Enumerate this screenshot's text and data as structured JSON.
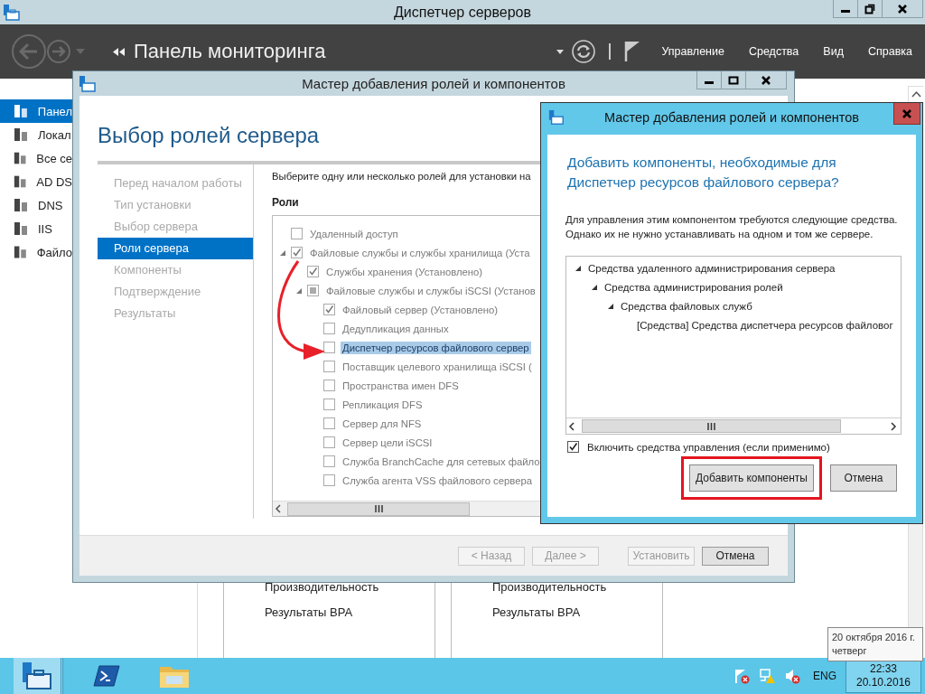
{
  "window": {
    "title": "Диспетчер серверов"
  },
  "header": {
    "breadcrumb": "Панель мониторинга",
    "menu": [
      "Управление",
      "Средства",
      "Вид",
      "Справка"
    ]
  },
  "sidebar": {
    "items": [
      {
        "label": "Панел",
        "selected": true
      },
      {
        "label": "Локал",
        "selected": false
      },
      {
        "label": "Все се",
        "selected": false
      },
      {
        "label": "AD DS",
        "selected": false
      },
      {
        "label": "DNS",
        "selected": false
      },
      {
        "label": "IIS",
        "selected": false
      },
      {
        "label": "Файло",
        "selected": false
      }
    ]
  },
  "tiles": [
    {
      "lines": [
        "Производительность",
        "Результаты BPA"
      ]
    },
    {
      "lines": [
        "Производительность",
        "Результаты BPA"
      ]
    }
  ],
  "wizard": {
    "title": "Мастер добавления ролей и компонентов",
    "heading": "Выбор ролей сервера",
    "steps": [
      {
        "label": "Перед началом работы",
        "selected": false
      },
      {
        "label": "Тип установки",
        "selected": false
      },
      {
        "label": "Выбор сервера",
        "selected": false
      },
      {
        "label": "Роли сервера",
        "selected": true
      },
      {
        "label": "Компоненты",
        "selected": false
      },
      {
        "label": "Подтверждение",
        "selected": false
      },
      {
        "label": "Результаты",
        "selected": false
      }
    ],
    "instruction": "Выберите одну или несколько ролей для установки на",
    "roles_label": "Роли",
    "roles": [
      {
        "label": "Удаленный доступ",
        "checked": false,
        "indeterminate": false,
        "selected": false
      },
      {
        "label": "Файловые службы и службы хранилища (Уста",
        "checked": true,
        "indeterminate": false,
        "selected": false,
        "expanded": true,
        "children": [
          {
            "label": "Службы хранения (Установлено)",
            "checked": true,
            "indeterminate": false,
            "selected": false
          },
          {
            "label": "Файловые службы и службы iSCSI (Установ",
            "checked": true,
            "indeterminate": true,
            "selected": false,
            "expanded": true,
            "children": [
              {
                "label": "Файловый сервер (Установлено)",
                "checked": true,
                "indeterminate": false,
                "selected": false
              },
              {
                "label": "Дедупликация данных",
                "checked": false,
                "indeterminate": false,
                "selected": false
              },
              {
                "label": "Диспетчер ресурсов файлового сервер",
                "checked": false,
                "indeterminate": false,
                "selected": true
              },
              {
                "label": "Поставщик целевого хранилища iSCSI (",
                "checked": false,
                "indeterminate": false,
                "selected": false
              },
              {
                "label": "Пространства имен DFS",
                "checked": false,
                "indeterminate": false,
                "selected": false
              },
              {
                "label": "Репликация DFS",
                "checked": false,
                "indeterminate": false,
                "selected": false
              },
              {
                "label": "Сервер для NFS",
                "checked": false,
                "indeterminate": false,
                "selected": false
              },
              {
                "label": "Сервер цели iSCSI",
                "checked": false,
                "indeterminate": false,
                "selected": false
              },
              {
                "label": "Служба BranchCache для сетевых файло",
                "checked": false,
                "indeterminate": false,
                "selected": false
              },
              {
                "label": "Служба агента VSS файлового сервера",
                "checked": false,
                "indeterminate": false,
                "selected": false
              }
            ]
          }
        ]
      }
    ],
    "buttons": [
      {
        "label": "< Назад",
        "disabled": true
      },
      {
        "label": "Далее >",
        "disabled": true
      },
      {
        "label": "Установить",
        "disabled": true
      },
      {
        "label": "Отмена",
        "disabled": false
      }
    ]
  },
  "dialog": {
    "title": "Мастер добавления ролей и компонентов",
    "question": "Добавить компоненты, необходимые для Диспетчер ресурсов файлового сервера?",
    "description": "Для управления этим компонентом требуются следующие средства. Однако их не нужно устанавливать на одном и том же сервере.",
    "tools": [
      {
        "label": "Средства удаленного администрирования сервера",
        "expanded": true,
        "children": [
          {
            "label": "Средства администрирования ролей",
            "expanded": true,
            "children": [
              {
                "label": "Средства файловых служб",
                "expanded": true,
                "children": [
                  {
                    "label": "[Средства] Средства диспетчера ресурсов файловог"
                  }
                ]
              }
            ]
          }
        ]
      }
    ],
    "include_tools": {
      "label": "Включить средства управления (если применимо)",
      "checked": true
    },
    "buttons": [
      {
        "label": "Добавить компоненты",
        "highlighted": true
      },
      {
        "label": "Отмена",
        "highlighted": false
      }
    ]
  },
  "tooltip": {
    "lines": [
      "20 октября 2016 г.",
      "четверг"
    ]
  },
  "taskbar": {
    "apps": [
      {
        "kind": "server",
        "selected": true
      },
      {
        "kind": "shell",
        "selected": false
      },
      {
        "kind": "folder",
        "selected": false
      }
    ],
    "language": "ENG",
    "time": "22:33",
    "date": "20.10.2016"
  }
}
